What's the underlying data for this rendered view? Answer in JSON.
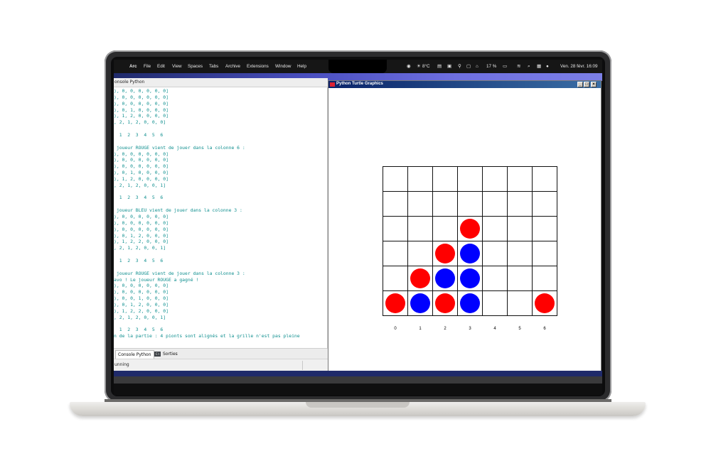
{
  "menubar": {
    "app_name": "Arc",
    "items": [
      "File",
      "Edit",
      "View",
      "Spaces",
      "Tabs",
      "Archive",
      "Extensions",
      "Window",
      "Help"
    ],
    "weather": "8°C",
    "battery": "17 %",
    "datetime": "Ven. 28 févr.  16:09"
  },
  "ide": {
    "panel_title": "onsole Python",
    "console_lines": [
      "), 0, 0, 0, 0, 0, 0]",
      "), 0, 0, 0, 0, 0, 0]",
      "), 0, 0, 0, 0, 0, 0]",
      "), 0, 1, 0, 0, 0, 0]",
      "), 1, 2, 0, 0, 0, 0]",
      ", 2, 1, 2, 0, 0, 0]",
      "",
      "  1  2  3  4  5  6",
      "",
      " joueur ROUGE vient de jouer dans la colonne 6 :",
      "), 0, 0, 0, 0, 0, 0]",
      "), 0, 0, 0, 0, 0, 0]",
      "), 0, 0, 0, 0, 0, 0]",
      "), 0, 1, 0, 0, 0, 0]",
      "), 1, 2, 0, 0, 0, 0]",
      ", 2, 1, 2, 0, 0, 1]",
      "",
      "  1  2  3  4  5  6",
      "",
      " joueur BLEU vient de jouer dans la colonne 3 :",
      "), 0, 0, 0, 0, 0, 0]",
      "), 0, 0, 0, 0, 0, 0]",
      "), 0, 0, 0, 0, 0, 0]",
      "), 0, 1, 2, 0, 0, 0]",
      "), 1, 2, 2, 0, 0, 0]",
      ", 2, 1, 2, 0, 0, 1]",
      "",
      "  1  2  3  4  5  6",
      "",
      " joueur ROUGE vient de jouer dans la colonne 3 :",
      "avo ! Le joueur ROUGE a gagné !",
      "), 0, 0, 0, 0, 0, 0]",
      "), 0, 0, 0, 0, 0, 0]",
      "), 0, 0, 1, 0, 0, 0]",
      "), 0, 1, 2, 0, 0, 0]",
      "), 1, 2, 2, 0, 0, 0]",
      ", 2, 1, 2, 0, 0, 1]",
      "",
      "  1  2  3  4  5  6",
      "n de la partie : 4 pionts sont alignés et la grille n'est pas pleine"
    ],
    "tabs": [
      {
        "label": "Console Python",
        "active": true
      },
      {
        "label": "Sorties",
        "active": false,
        "icon": "terminal-icon"
      }
    ],
    "status": "unning"
  },
  "turtle": {
    "title": "Python Turtle Graphics",
    "colors": {
      "red": "#ff0000",
      "blue": "#0000ff"
    },
    "column_labels": [
      "0",
      "1",
      "2",
      "3",
      "4",
      "5",
      "6"
    ],
    "discs": [
      {
        "row": 2,
        "col": 3,
        "color": "red"
      },
      {
        "row": 3,
        "col": 2,
        "color": "red"
      },
      {
        "row": 3,
        "col": 3,
        "color": "blue"
      },
      {
        "row": 4,
        "col": 1,
        "color": "red"
      },
      {
        "row": 4,
        "col": 2,
        "color": "blue"
      },
      {
        "row": 4,
        "col": 3,
        "color": "blue"
      },
      {
        "row": 5,
        "col": 0,
        "color": "red"
      },
      {
        "row": 5,
        "col": 1,
        "color": "blue"
      },
      {
        "row": 5,
        "col": 2,
        "color": "red"
      },
      {
        "row": 5,
        "col": 3,
        "color": "blue"
      },
      {
        "row": 5,
        "col": 6,
        "color": "red"
      }
    ]
  }
}
